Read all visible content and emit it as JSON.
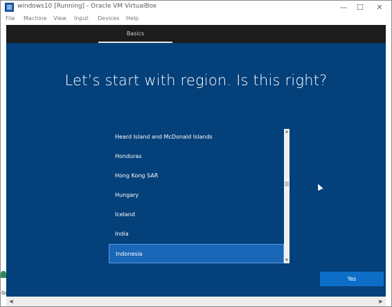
{
  "window": {
    "title": "windows10 [Running] - Oracle VM VirtualBox",
    "minimize_glyph": "—",
    "maximize_glyph": "☐",
    "close_glyph": "✕"
  },
  "menubar": {
    "items": [
      "File",
      "Machine",
      "View",
      "Input",
      "Devices",
      "Help"
    ]
  },
  "setup": {
    "tab_label": "Basics",
    "heading": "Let’s start with region. Is this right?",
    "regions": [
      "Heard Island and McDonald Islands",
      "Honduras",
      "Hong Kong SAR",
      "Hungary",
      "Iceland",
      "India",
      "Indonesia"
    ],
    "selected_region": "Indonesia",
    "yes_label": "Yes"
  },
  "desktop": {
    "icon_caption": "Gc"
  },
  "colors": {
    "setup_bg": "#04407a",
    "header_bg": "#1c1c1c",
    "selected_row": "#1a67b8",
    "primary_button": "#0d6ec7"
  }
}
